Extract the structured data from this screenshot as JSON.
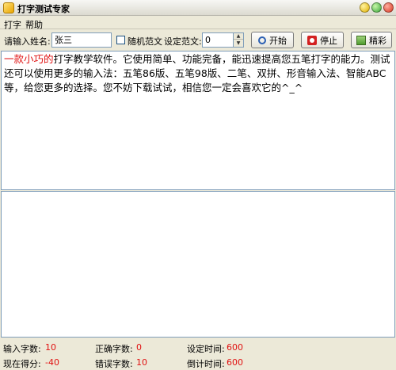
{
  "window": {
    "title": "打字测试专家"
  },
  "menu": {
    "items": [
      {
        "label": "打字"
      },
      {
        "label": "帮助"
      }
    ]
  },
  "toolbar": {
    "name_label": "请输入姓名:",
    "name_value": "张三",
    "random_label": "随机范文",
    "random_checked": false,
    "text_label": "设定范文:",
    "text_value": "0",
    "start_label": "开始",
    "stop_label": "停止",
    "wonderful_label": "精彩"
  },
  "sample": {
    "typed_part": "一款小巧的",
    "remaining_part": "打字教学软件。它使用简单、功能完备，能迅速提高您五笔打字的能力。测试还可以使用更多的输入法：五笔86版、五笔98版、二笔、双拼、形音输入法、智能ABC等，给您更多的选择。您不妨下载试试，相信您一定会喜欢它的^_^"
  },
  "status": {
    "input_chars_label": "输入字数:",
    "input_chars": "10",
    "correct_chars_label": "正确字数:",
    "correct_chars": "0",
    "set_time_label": "设定时间:",
    "set_time": "600",
    "score_label": "现在得分:",
    "score": "-40",
    "error_chars_label": "错误字数:",
    "error_chars": "10",
    "countdown_label": "倒计时间:",
    "countdown": "600"
  },
  "colors": {
    "highlight": "#e01010",
    "background": "#ece9d8"
  }
}
